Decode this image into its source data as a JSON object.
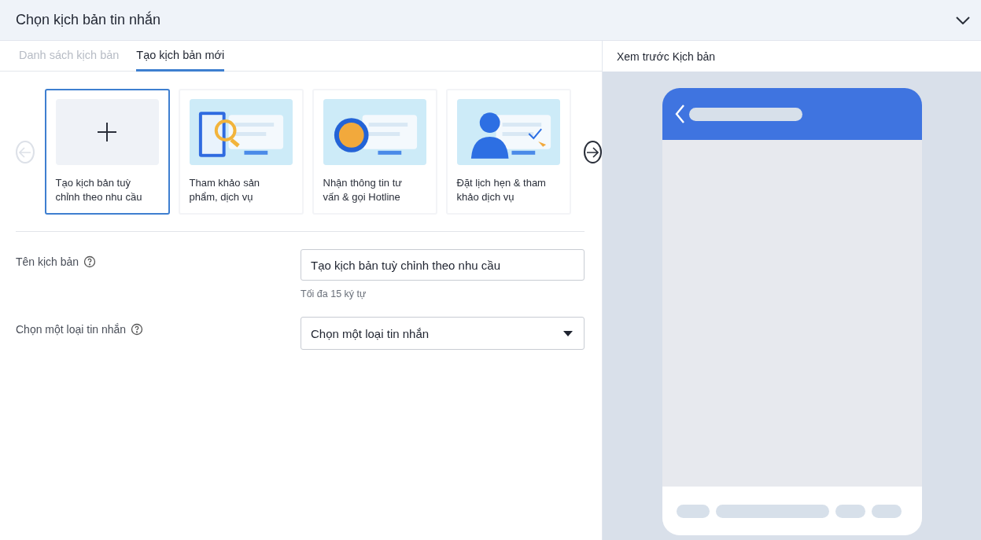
{
  "window": {
    "title": "Chọn kịch bản tin nhắn"
  },
  "tabs": [
    {
      "label": "Danh sách kịch bản",
      "selected": false
    },
    {
      "label": "Tạo kịch bản mới",
      "selected": true
    }
  ],
  "carousel": {
    "prev_disabled": true,
    "next_disabled": false,
    "cards": [
      {
        "kind": "create",
        "label": "Tạo kịch bản tuỳ chỉnh theo nhu cầu",
        "selected": true
      },
      {
        "kind": "picture",
        "label": "Tham khảo sản phẩm, dịch vụ",
        "selected": false
      },
      {
        "kind": "picture",
        "label": "Nhận thông tin tư vấn & gọi Hotline",
        "selected": false
      },
      {
        "kind": "picture",
        "label": "Đặt lịch hẹn & tham khảo dịch vụ",
        "selected": false
      }
    ]
  },
  "form": [
    {
      "kind": "text",
      "label": "Tên kịch bản",
      "value": "Tạo kịch bản tuỳ chỉnh theo nhu cầu",
      "hint": "Tối đa 15 ký tự"
    },
    {
      "kind": "select",
      "label": "Chọn một loại tin nhắn",
      "placeholder": "Chọn một loại tin nhắn"
    }
  ],
  "preview": {
    "title": "Xem trước Kịch bản"
  }
}
